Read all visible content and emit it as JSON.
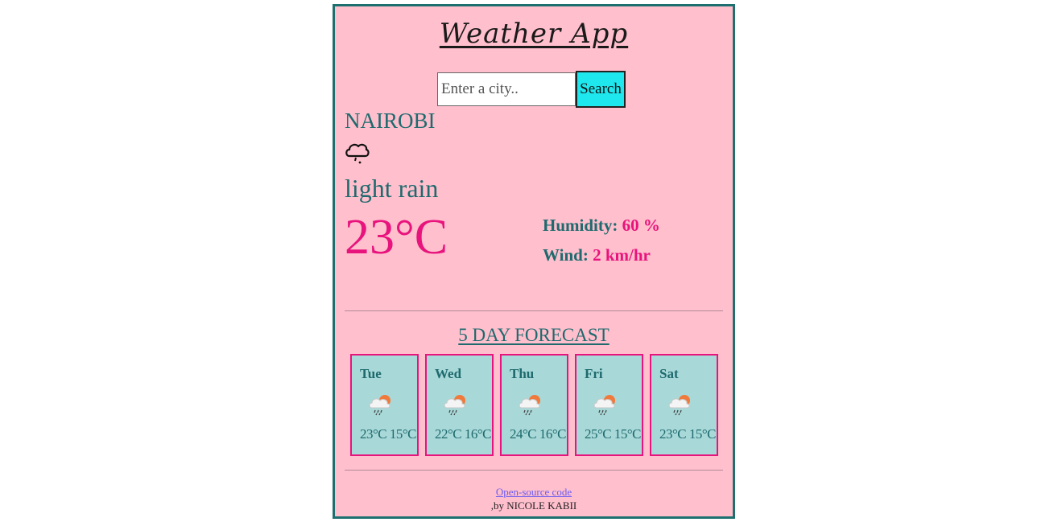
{
  "app": {
    "title": "Weather App"
  },
  "search": {
    "placeholder": "Enter a city..",
    "value": "",
    "button_label": "Search"
  },
  "current": {
    "city": "NAIROBI",
    "icon": "rain-cloud-icon",
    "description": "light rain",
    "temperature": "23°C",
    "humidity_label": "Humidity:",
    "humidity_value": "60 %",
    "wind_label": "Wind:",
    "wind_value": "2 km/hr"
  },
  "forecast": {
    "title": "5 DAY FORECAST",
    "days": [
      {
        "day": "Tue",
        "icon": "sun-behind-rain-cloud-icon",
        "temps": "23°C 15°C"
      },
      {
        "day": "Wed",
        "icon": "sun-behind-rain-cloud-icon",
        "temps": "22°C 16°C"
      },
      {
        "day": "Thu",
        "icon": "sun-behind-rain-cloud-icon",
        "temps": "24°C 16°C"
      },
      {
        "day": "Fri",
        "icon": "sun-behind-rain-cloud-icon",
        "temps": "25°C 15°C"
      },
      {
        "day": "Sat",
        "icon": "sun-behind-rain-cloud-icon",
        "temps": "23°C 15°C"
      }
    ]
  },
  "footer": {
    "link_text": "Open-source code",
    "credit": ",by NICOLE KABII"
  },
  "colors": {
    "background": "#ffbfcd",
    "border": "#1e7070",
    "accent": "#e8137c",
    "text_teal": "#1e6a6e",
    "card_bg": "#a8d8d8",
    "button_bg": "#1ee8ee"
  }
}
